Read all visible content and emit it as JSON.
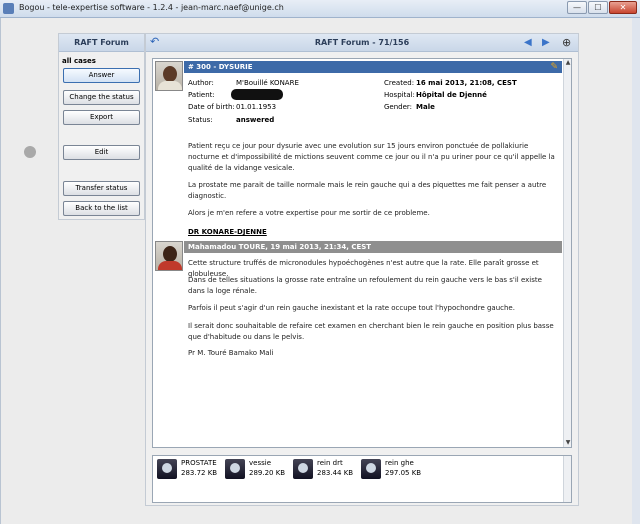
{
  "window": {
    "title": "Bogou - tele-expertise software - 1.2.4 - jean-marc.naef@unige.ch",
    "min_glyph": "—",
    "max_glyph": "☐",
    "close_glyph": "✕"
  },
  "sidebar": {
    "header": "RAFT Forum",
    "filter_label": "all cases",
    "buttons": {
      "answer": "Answer",
      "change_status": "Change the status",
      "export": "Export",
      "edit": "Edit",
      "transfer_status": "Transfer status",
      "back_to_list": "Back to the list"
    }
  },
  "main": {
    "title": "RAFT Forum - 71/156",
    "case": {
      "header": "# 300 - DYSURIE",
      "fields": {
        "author_label": "Author:",
        "author_value": "M'Bouillé KONARE",
        "patient_label": "Patient:",
        "dob_label": "Date of birth:",
        "dob_value": "01.01.1953",
        "status_label": "Status:",
        "status_value": "answered",
        "created_label": "Created:",
        "created_value": "16 mai 2013, 21:08, CEST",
        "hospital_label": "Hospital:",
        "hospital_value": "Hôpital de Djenné",
        "gender_label": "Gender:",
        "gender_value": "Male"
      },
      "paragraphs": [
        "Patient reçu ce jour pour dysurie avec une evolution sur 15 jours environ ponctuée de pollakiurie nocturne et d'impossibilité de mictions seuvent comme ce jour ou il n'a pu uriner pour ce qu'il appelle la qualité de la vidange vesicale.",
        "La prostate me parait de taille normale mais le rein gauche qui a des piquettes me fait penser a autre diagnostic.",
        "Alors je m'en refere a votre expertise pour me sortir de ce probleme."
      ],
      "signature": "DR KONARE-DJENNE"
    },
    "reply": {
      "header": "Mahamadou TOURE, 19 mai 2013, 21:34, CEST",
      "paragraphs": [
        "Cette structure truffés de micronodules hypoéchogènes n'est autre que la rate. Elle paraît grosse et globuleuse.",
        "Dans de telles situations la grosse rate entraîne un refoulement du rein gauche vers le bas s'il existe dans la loge rénale.",
        "Parfois il peut s'agir d'un rein gauche inexistant et la rate occupe tout l'hypochondre gauche.",
        "Il serait donc souhaitable de refaire cet examen en cherchant bien le rein gauche en position plus basse que d'habitude ou dans le pelvis.",
        "Pr M. Touré Bamako Mali"
      ]
    },
    "attachments": [
      {
        "name": "PROSTATE",
        "size": "283.72 KB"
      },
      {
        "name": "vessie",
        "size": "289.20 KB"
      },
      {
        "name": "rein drt",
        "size": "283.44 KB"
      },
      {
        "name": "rein ghe",
        "size": "297.05 KB"
      }
    ]
  },
  "icons": {
    "refresh": "↶",
    "prev": "◀",
    "next": "▶",
    "zoom": "⊕",
    "clip": "✎",
    "scroll_up": "▲",
    "scroll_down": "▼"
  },
  "colors": {
    "case_bar": "#3d6aa8",
    "reply_bar": "#8f8f8f",
    "header_gradient_top": "#dfe8f3"
  }
}
